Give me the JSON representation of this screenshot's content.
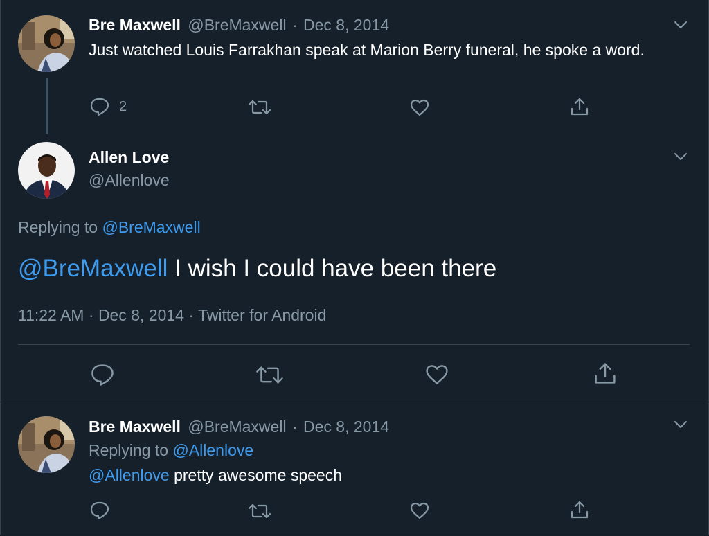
{
  "tweet1": {
    "name": "Bre Maxwell",
    "handle": "@BreMaxwell",
    "sep": "·",
    "date": "Dec 8, 2014",
    "text": "Just watched Louis Farrakhan speak at Marion Berry funeral, he spoke a word.",
    "reply_count": "2"
  },
  "main": {
    "name": "Allen Love",
    "handle": "@Allenlove",
    "replying_prefix": "Replying to",
    "replying_to": "@BreMaxwell",
    "mention": "@BreMaxwell",
    "text": "I wish I could have been there",
    "time": "11:22 AM",
    "sep1": "·",
    "date": "Dec 8, 2014",
    "sep2": "·",
    "source": "Twitter for Android"
  },
  "tweet3": {
    "name": "Bre Maxwell",
    "handle": "@BreMaxwell",
    "sep": "·",
    "date": "Dec 8, 2014",
    "replying_prefix": "Replying to",
    "replying_to": "@Allenlove",
    "mention": "@Allenlove",
    "text": "pretty awesome speech"
  },
  "colors": {
    "background": "#15202b",
    "muted": "#8899a6",
    "link": "#3f9bee",
    "border": "#38444d"
  },
  "icons": [
    "chevron-down-icon",
    "reply-icon",
    "retweet-icon",
    "like-icon",
    "share-icon"
  ]
}
